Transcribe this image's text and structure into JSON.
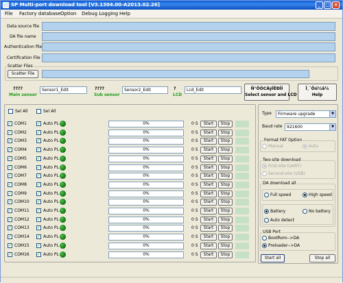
{
  "window": {
    "title": "SP Multi-port download tool [V3.1304.00-A2013.02.26]"
  },
  "menu": [
    "File",
    "Factory database",
    "Option",
    "Debug Logging",
    "Help"
  ],
  "files": [
    {
      "label": "Data source file"
    },
    {
      "label": "DA file name"
    },
    {
      "label": "Authentication file"
    },
    {
      "label": "Certification File"
    }
  ],
  "scatter": {
    "group_label": "Scatter Files",
    "button": "Scatter File"
  },
  "sensors": {
    "main": {
      "qmark": "????",
      "label": "Main sensor",
      "value": "Sensor1_Edit"
    },
    "sub": {
      "qmark": "????",
      "label": "Sub sensor",
      "value": "Sensor2_Edit"
    },
    "lcd": {
      "qmark": "?",
      "label": "LCD",
      "value": "Lcd_Edit"
    },
    "select_button": {
      "line1": "Ñ°ÕÒCÁýÎÊÐÎÌ",
      "line2": "Select sensor and LCD"
    },
    "help_button": {
      "line1": "Ï¸¨Öú½â¼",
      "line2": "Help"
    }
  },
  "sel_all": {
    "left": "Sel All",
    "right": "Sel All"
  },
  "row_common": {
    "auto_label": "Auto PL",
    "progress": "0%",
    "time": "0 S",
    "start": "Start",
    "stop": "Stop"
  },
  "coms": [
    "COM1",
    "COM2",
    "COM3",
    "COM4",
    "COM5",
    "COM6",
    "COM7",
    "COM8",
    "COM9",
    "COM10",
    "COM11",
    "COM12",
    "COM13",
    "COM14",
    "COM15",
    "COM16"
  ],
  "type": {
    "label": "Type",
    "value": "Firmware upgrade"
  },
  "baud": {
    "label": "Baud rate",
    "value": "921600"
  },
  "fat": {
    "title": "Format FAT Option",
    "manual": "Manual",
    "auto": "Auto"
  },
  "twosite": {
    "title": "Two-site download",
    "first": "First-site (UART)",
    "second": "Second-site (USB)"
  },
  "da": {
    "title": "DA download all",
    "full_speed": "Full speed",
    "high_speed": "High speed",
    "battery": "Battery",
    "no_battery": "No battery",
    "auto_detect": "Auto detect"
  },
  "usb": {
    "title": "USB Port",
    "bootrom": "BootRom-->DA",
    "preloader": "Preloader-->DA"
  },
  "actions": {
    "start_all": "Start all",
    "stop_all": "Stop all"
  },
  "colors": {
    "titlebar": "#0a5fd8",
    "window": "#ece9d8",
    "field": "#b4d2ee",
    "led": "#1d8f1d",
    "green_text": "#1a9a1a"
  }
}
